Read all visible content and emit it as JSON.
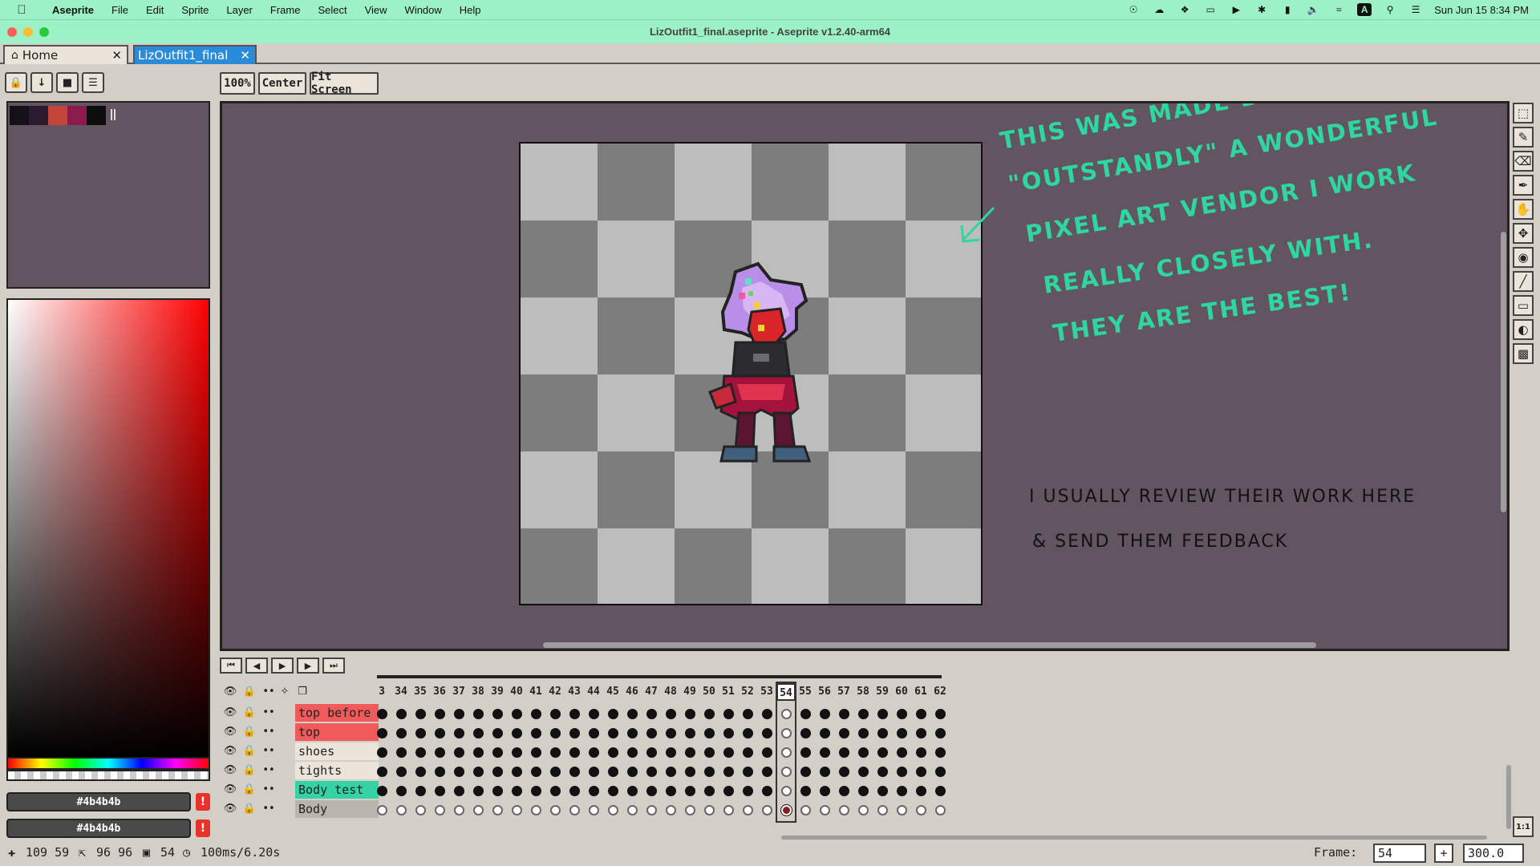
{
  "menubar": {
    "app_name": "Aseprite",
    "menus": [
      "File",
      "Edit",
      "Sprite",
      "Layer",
      "Frame",
      "Select",
      "View",
      "Window",
      "Help"
    ],
    "clock": "Sun Jun 15  8:34 PM",
    "input_source": "A"
  },
  "window": {
    "title": "LizOutfit1_final.aseprite - Aseprite v1.2.40-arm64"
  },
  "tabs": {
    "home_label": "Home",
    "doc_label": "LizOutfit1_final"
  },
  "zoom_toolbar": {
    "zoom_label": "100%",
    "center_label": "Center",
    "fit_label": "Fit Screen"
  },
  "palette": {
    "colors": [
      "#141018",
      "#2a1a30",
      "#c3453a",
      "#8a1b4c",
      "#0c0c0c"
    ]
  },
  "color_bar": {
    "fg_hex": "#4b4b4b",
    "bg_hex": "#4b4b4b",
    "warning_glyph": "!"
  },
  "annotations": {
    "green_lines": [
      "This was made by",
      "\"Outstandly\" a wonderful",
      "pixel art vendor I work",
      "really closely with.",
      "They are the best!"
    ],
    "black_lines": [
      "I usually review their work here",
      "& send them feedback"
    ],
    "green_color": "#2fd6a0"
  },
  "timeline": {
    "frame_numbers": [
      "3",
      "34",
      "35",
      "36",
      "37",
      "38",
      "39",
      "40",
      "41",
      "42",
      "43",
      "44",
      "45",
      "46",
      "47",
      "48",
      "49",
      "50",
      "51",
      "52",
      "53",
      "54",
      "55",
      "56",
      "57",
      "58",
      "59",
      "60",
      "61",
      "62"
    ],
    "current_frame": "54",
    "layers": [
      {
        "name": "top before",
        "color": "#f05a5a",
        "filled": true
      },
      {
        "name": "top",
        "color": "#f05a5a",
        "filled": true
      },
      {
        "name": "shoes",
        "color": "#eae4da",
        "filled": true
      },
      {
        "name": "tights",
        "color": "#eae4da",
        "filled": true
      },
      {
        "name": "Body test",
        "color": "#34d2a4",
        "filled": true
      },
      {
        "name": "Body",
        "color": "#b9b4ac",
        "filled": false
      }
    ]
  },
  "statusbar": {
    "cursor_pos": "109 59",
    "sprite_size": "96 96",
    "frame_count": "54",
    "duration": "100ms/6.20s",
    "frame_label": "Frame:",
    "frame_value": "54",
    "zoom_value": "300.0"
  }
}
